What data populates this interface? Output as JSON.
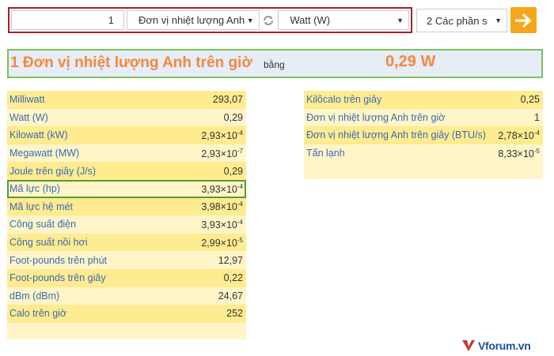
{
  "converter": {
    "amount": "1",
    "from_unit": "Đơn vị nhiệt lượng Anh",
    "to_unit": "Watt (W)",
    "precision": "2 Các phần s"
  },
  "result": {
    "quantity_text": "1 Đơn vị nhiệt lượng Anh trên giờ",
    "equals_text": "bằng",
    "value": "0,29 W"
  },
  "left_table": [
    {
      "label": "Milliwatt",
      "value": "293,07",
      "exp": ""
    },
    {
      "label": "Watt (W)",
      "value": "0,29",
      "exp": ""
    },
    {
      "label": "Kilowatt (kW)",
      "value": "2,93×10",
      "exp": "-4"
    },
    {
      "label": "Megawatt (MW)",
      "value": "2,93×10",
      "exp": "-7"
    },
    {
      "label": "Joule trên giây (J/s)",
      "value": "0,29",
      "exp": ""
    },
    {
      "label": "Mã lực (hp)",
      "value": "3,93×10",
      "exp": "-4"
    },
    {
      "label": "Mã lực hệ mét",
      "value": "3,98×10",
      "exp": "-4"
    },
    {
      "label": "Công suất điện",
      "value": "3,93×10",
      "exp": "-4"
    },
    {
      "label": "Công suất nồi hơi",
      "value": "2,99×10",
      "exp": "-5"
    },
    {
      "label": "Foot-pounds trên phút",
      "value": "12,97",
      "exp": ""
    },
    {
      "label": "Foot-pounds trên giây",
      "value": "0,22",
      "exp": ""
    },
    {
      "label": "dBm (dBm)",
      "value": "24,67",
      "exp": ""
    },
    {
      "label": "Calo trên giờ",
      "value": "252",
      "exp": ""
    }
  ],
  "right_table": [
    {
      "label": "Kilôcalo trên giây",
      "value": "0,25",
      "exp": ""
    },
    {
      "label": "Đơn vị nhiệt lượng Anh trên giờ",
      "value": "1",
      "exp": ""
    },
    {
      "label": "Đơn vị nhiệt lượng Anh trên giây (BTU/s)",
      "value": "2,78×10",
      "exp": "-4"
    },
    {
      "label": "Tấn lạnh",
      "value": "8,33×10",
      "exp": "-5"
    }
  ],
  "watermark": {
    "text": "Vforum.vn"
  },
  "colors": {
    "accent_orange": "#f5873b",
    "button_orange": "#f5a71b",
    "link_blue": "#3a6bb5",
    "row_light": "#fff5c8",
    "row_dark": "#ffeb90",
    "highlight_green": "#7ec15a",
    "frame_red": "#a0202a"
  },
  "icons": {
    "swap": "swap-arrows-icon",
    "go": "arrow-right-icon",
    "dropdown": "caret-down-icon"
  }
}
